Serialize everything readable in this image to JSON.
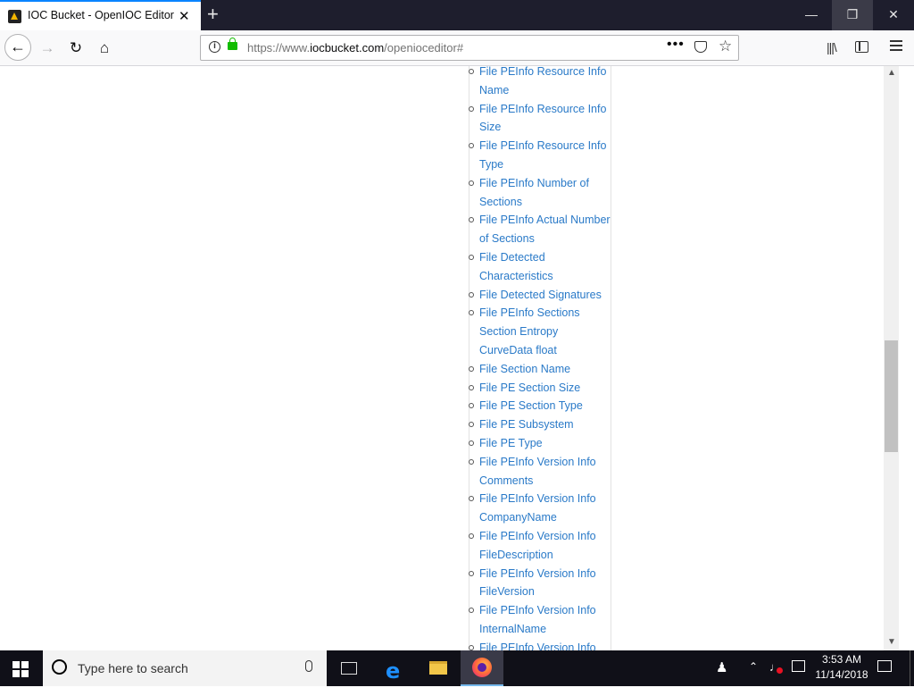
{
  "browser": {
    "tab_title": "IOC Bucket - OpenIOC Editor",
    "tab_close": "✕",
    "new_tab": "+",
    "url_prefix": "https://www.",
    "url_host": "iocbucket.com",
    "url_path": "/openioceditor#",
    "page_actions": "•••",
    "window_minimize": "—",
    "window_restore": "❐",
    "window_close": "✕"
  },
  "ioc_terms": [
    "File PEInfo Resource Info Name",
    "File PEInfo Resource Info Size",
    "File PEInfo Resource Info Type",
    "File PEInfo Number of Sections",
    "File PEInfo Actual Number of Sections",
    "File Detected Characteristics",
    "File Detected Signatures",
    "File PEInfo Sections Section Entropy CurveData float",
    "File Section Name",
    "File PE Section Size",
    "File PE Section Type",
    "File PE Subsystem",
    "File PE Type",
    "File PEInfo Version Info Comments",
    "File PEInfo Version Info CompanyName",
    "File PEInfo Version Info FileDescription",
    "File PEInfo Version Info FileVersion",
    "File PEInfo Version Info InternalName",
    "File PEInfo Version Info"
  ],
  "taskbar": {
    "search_placeholder": "Type here to search",
    "time": "3:53 AM",
    "date": "11/14/2018"
  },
  "colors": {
    "link": "#2a7ac8",
    "tab_accent": "#0a84ff",
    "secure_lock": "#12bc00"
  }
}
